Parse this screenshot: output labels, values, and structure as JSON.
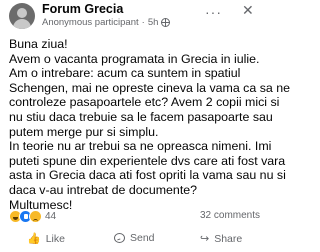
{
  "post": {
    "group_name": "Forum Grecia",
    "author": "Anonymous participant",
    "separator": "·",
    "time": "5h",
    "more_icon": "more-icon",
    "close_icon": "close-icon",
    "lines": [
      "Buna ziua!",
      "Avem o vacanta programata in Grecia in iulie.",
      "Am o intrebare: acum ca suntem in spatiul",
      "Schengen, mai ne opreste cineva la vama ca sa ne",
      "controleze pasapoartele etc? Avem 2 copii mici si",
      "nu stiu daca trebuie sa le facem pasapoarte sau",
      "putem merge pur si simplu.",
      "In teorie nu ar trebui sa ne opreasca nimeni. Imi",
      "puteti spune din experientele dvs care ati fost vara",
      "asta in Grecia daca ati fost opriti la vama sau nu si",
      "daca v-au intrebat de documente?",
      "Multumesc!"
    ]
  },
  "stats": {
    "reaction_count": "44",
    "comments": "32 comments",
    "reaction_icons": [
      "laugh-icon",
      "like-icon",
      "sad-icon"
    ]
  },
  "actions": {
    "like": "Like",
    "send": "Send",
    "share": "Share"
  },
  "icons": {
    "like_icon": "👍",
    "share_icon": "↪",
    "more_glyph": "···",
    "close_glyph": "✕"
  }
}
